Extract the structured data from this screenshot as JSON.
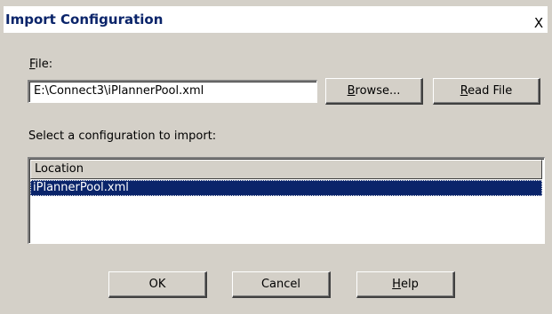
{
  "window": {
    "title": "Import Configuration",
    "close_glyph": "X"
  },
  "file": {
    "label_mnemonic": "F",
    "label_rest": "ile:",
    "value": "E:\\Connect3\\iPlannerPool.xml"
  },
  "buttons": {
    "browse_mnemonic": "B",
    "browse_rest": "rowse...",
    "readfile_mnemonic": "R",
    "readfile_rest": "ead File",
    "ok": "OK",
    "cancel": "Cancel",
    "help_mnemonic": "H",
    "help_rest": "elp"
  },
  "select_label": "Select a configuration to import:",
  "list": {
    "columns": [
      "Location"
    ],
    "rows": [
      {
        "location": "iPlannerPool.xml",
        "selected": true
      }
    ]
  },
  "colors": {
    "face": "#d4d0c8",
    "title_text": "#0a246a",
    "selection": "#0a246a"
  }
}
